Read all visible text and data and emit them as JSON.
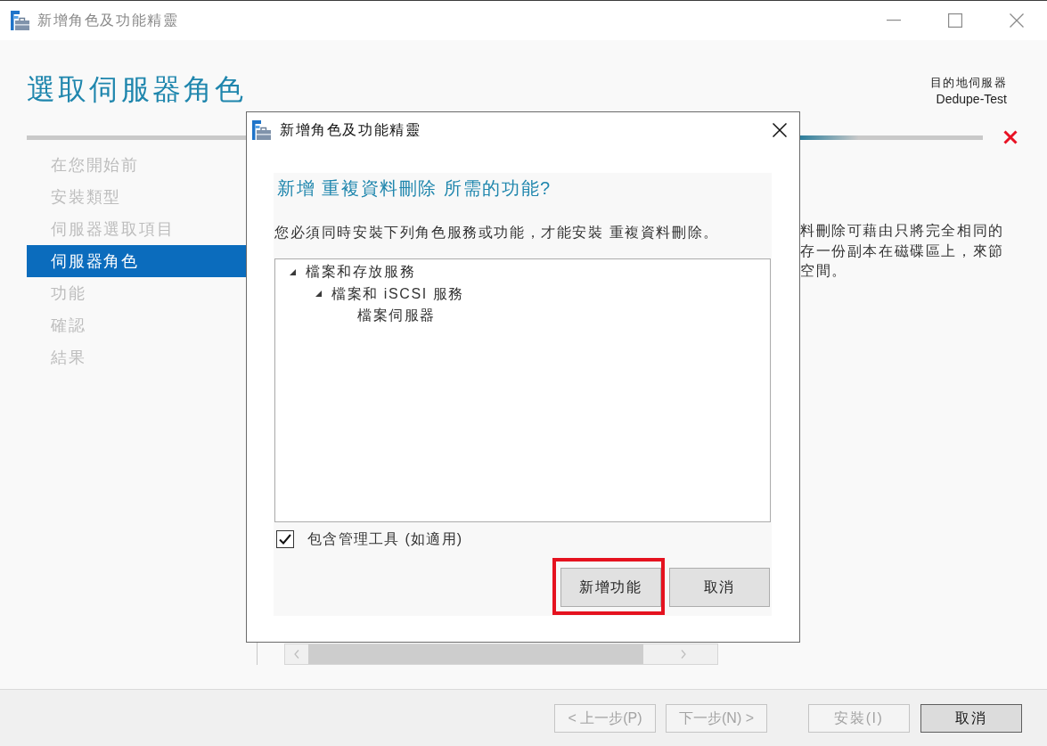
{
  "window": {
    "title": "新增角色及功能精靈"
  },
  "page": {
    "heading": "選取伺服器角色",
    "destination_label": "目的地伺服器",
    "destination_server": "Dedupe-Test"
  },
  "steps": [
    {
      "label": "在您開始前",
      "selected": false
    },
    {
      "label": "安裝類型",
      "selected": false
    },
    {
      "label": "伺服器選取項目",
      "selected": false
    },
    {
      "label": "伺服器角色",
      "selected": true
    },
    {
      "label": "功能",
      "selected": false
    },
    {
      "label": "確認",
      "selected": false
    },
    {
      "label": "結果",
      "selected": false
    }
  ],
  "description_lines": [
    "料刪除可藉由只將完全相同的",
    "存一份副本在磁碟區上，來節",
    "空間。"
  ],
  "navigation_buttons": [
    {
      "label": "< 上一步(P)",
      "disabled": true
    },
    {
      "label": "下一步(N) >",
      "disabled": true
    }
  ],
  "action_buttons": [
    {
      "label": "安裝(I)",
      "disabled": true
    },
    {
      "label": "取消",
      "disabled": false
    }
  ],
  "dialog": {
    "title": "新增角色及功能精靈",
    "heading": "新增 重複資料刪除 所需的功能?",
    "message": "您必須同時安裝下列角色服務或功能，才能安裝 重複資料刪除。",
    "tree": [
      {
        "label": "檔案和存放服務",
        "expanded": true,
        "children": [
          {
            "label": "檔案和 iSCSI 服務",
            "expanded": true,
            "children": [
              {
                "label": "檔案伺服器"
              }
            ]
          }
        ]
      }
    ],
    "include_tools": {
      "label": "包含管理工具 (如適用)",
      "checked": true
    },
    "buttons": [
      {
        "label": "新增功能",
        "highlighted": true
      },
      {
        "label": "取消",
        "highlighted": false
      }
    ]
  }
}
